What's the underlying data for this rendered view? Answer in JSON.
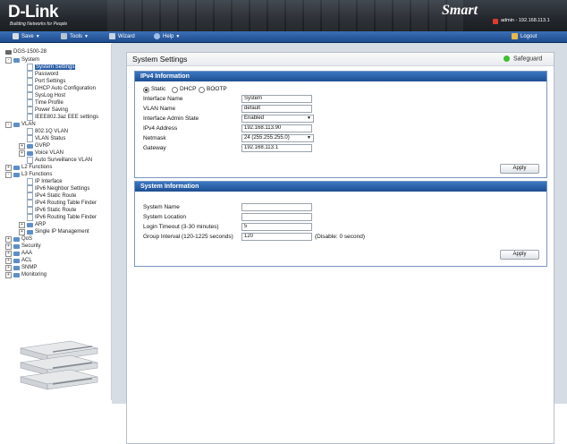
{
  "header": {
    "brand": "D-Link",
    "tagline": "Building Networks for People",
    "product_logo": "Smart",
    "user_info": "admin - 192.168.113.1"
  },
  "menubar": {
    "save": "Save",
    "tools": "Tools",
    "wizard": "Wizard",
    "help": "Help",
    "logout": "Logout"
  },
  "tree": {
    "root": "DGS-1500-28",
    "system": "System",
    "system_settings": "System Settings",
    "password": "Password",
    "port_settings": "Port Settings",
    "dhcp_auto": "DHCP Auto Configuration",
    "syslog": "SysLog Host",
    "time_profile": "Time Profile",
    "power_saving": "Power Saving",
    "ieee_eee": "IEEE802.3az EEE settings",
    "vlan": "VLAN",
    "vlan_8021q": "802.1Q VLAN",
    "vlan_status": "VLAN Status",
    "gvrp": "GVRP",
    "voice_vlan": "Voice VLAN",
    "auto_surv": "Auto Surveillance VLAN",
    "l2": "L2 Functions",
    "l3": "L3 Functions",
    "ip_interface": "IP Interface",
    "ipv6_neighbor": "IPv6 Neighbor Settings",
    "ipv4_static": "IPv4 Static Route",
    "ipv4_routing": "IPv4 Routing Table Finder",
    "ipv6_static": "IPv6 Static Route",
    "ipv6_routing": "IPv6 Routing Table Finder",
    "arp": "ARP",
    "single_ip": "Single IP Management",
    "qos": "QoS",
    "security": "Security",
    "aaa": "AAA",
    "acl": "ACL",
    "snmp": "SNMP",
    "monitoring": "Monitoring"
  },
  "page": {
    "title": "System Settings",
    "safeguard": "Safeguard"
  },
  "ipv4": {
    "heading": "IPv4 Information",
    "radio_static": "Static",
    "radio_dhcp": "DHCP",
    "radio_bootp": "BOOTP",
    "interface_name_label": "Interface Name",
    "interface_name": "System",
    "vlan_name_label": "VLAN Name",
    "vlan_name": "default",
    "admin_state_label": "Interface Admin State",
    "admin_state": "Enabled",
    "ip_label": "IPv4 Address",
    "ip": "192.168.113.90",
    "netmask_label": "Netmask",
    "netmask": "24 (255.255.255.0)",
    "gateway_label": "Gateway",
    "gateway": "192.168.113.1",
    "apply": "Apply"
  },
  "sysinfo": {
    "heading": "System Information",
    "name_label": "System Name",
    "name": "",
    "location_label": "System Location",
    "location": "",
    "timeout_label": "Login Timeout (3-30 minutes)",
    "timeout": "5",
    "group_label": "Group Interval (120-1225 seconds)",
    "group": "120",
    "group_hint": "(Disable: 0 second)",
    "apply": "Apply"
  }
}
